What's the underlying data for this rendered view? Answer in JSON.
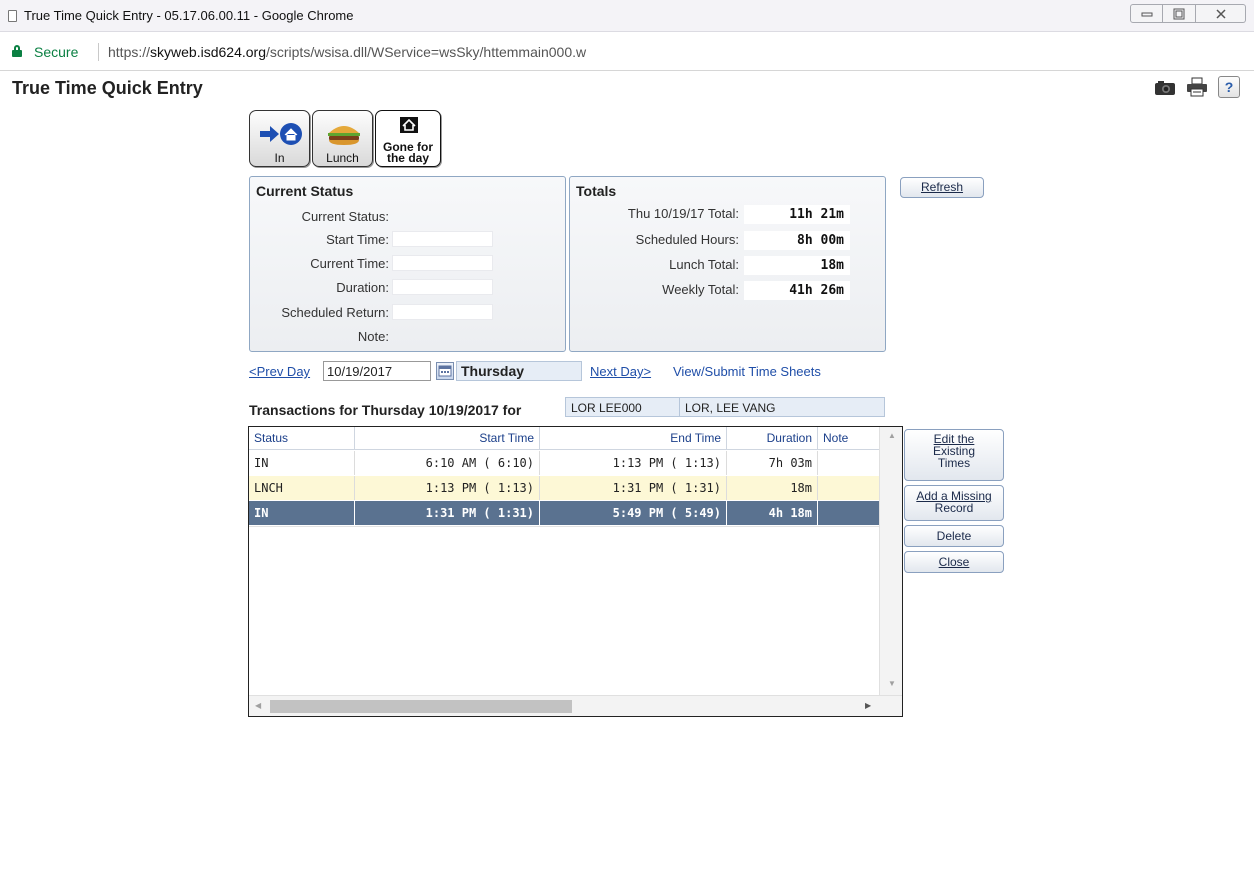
{
  "browser": {
    "window_title": "True Time Quick Entry - 05.17.06.00.11 - Google Chrome",
    "secure_label": "Secure",
    "url_scheme": "https://",
    "url_host": "skyweb.isd624.org",
    "url_path": "/scripts/wsisa.dll/WService=wsSky/httemmain000.w"
  },
  "app": {
    "title": "True Time Quick Entry"
  },
  "punch_buttons": {
    "in_label": "In",
    "lunch_label": "Lunch",
    "gone_label_line1": "Gone for",
    "gone_label_line2": "the day"
  },
  "current_status": {
    "heading": "Current Status",
    "fields": {
      "status_label": "Current Status:",
      "start_label": "Start Time:",
      "current_label": "Current Time:",
      "duration_label": "Duration:",
      "sched_return_label": "Scheduled Return:",
      "note_label": "Note:"
    }
  },
  "totals": {
    "heading": "Totals",
    "day_label": "Thu 10/19/17 Total:",
    "day_value": "11h 21m",
    "scheduled_label": "Scheduled Hours:",
    "scheduled_value": "8h 00m",
    "lunch_label": "Lunch Total:",
    "lunch_value": "18m",
    "weekly_label": "Weekly Total:",
    "weekly_value": "41h 26m"
  },
  "actions": {
    "refresh": "Refresh",
    "edit_line1": "Edit the",
    "edit_line2": "Existing",
    "edit_line3": "Times",
    "add_line1": "Add a Missing",
    "add_line2": "Record",
    "delete": "Delete",
    "close": "Close"
  },
  "date_nav": {
    "prev": "<Prev Day",
    "date_value": "10/19/2017",
    "day_name": "Thursday",
    "next": "Next Day>",
    "timesheets": "View/Submit Time Sheets"
  },
  "transactions": {
    "title": "Transactions for Thursday 10/19/2017 for",
    "employee_id": "LOR  LEE000",
    "employee_name": "LOR, LEE VANG",
    "columns": [
      "Status",
      "Start Time",
      "End Time",
      "Duration",
      "Note"
    ],
    "rows": [
      {
        "status": "IN",
        "start": "6:10 AM ( 6:10)",
        "end": "1:13 PM ( 1:13)",
        "duration": "7h 03m",
        "note": ""
      },
      {
        "status": "LNCH",
        "start": "1:13 PM ( 1:13)",
        "end": "1:31 PM ( 1:31)",
        "duration": "18m",
        "note": ""
      },
      {
        "status": "IN",
        "start": "1:31 PM ( 1:31)",
        "end": "5:49 PM ( 5:49)",
        "duration": "4h 18m",
        "note": ""
      }
    ]
  },
  "colors": {
    "selected_row": "#5a7290",
    "lunch_row": "#fdf8d6",
    "link": "#1f4ea8",
    "secure": "#0b8043"
  }
}
